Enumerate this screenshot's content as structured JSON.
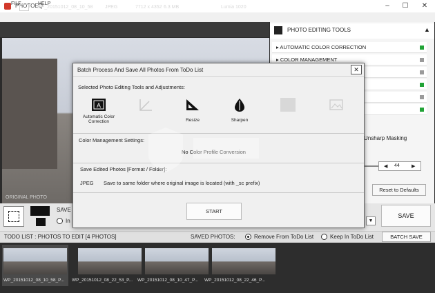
{
  "window": {
    "title": "PHOTOEQ",
    "controls": [
      "–",
      "☐",
      "✕"
    ]
  },
  "menu": [
    "FILE",
    "HELP"
  ],
  "info": {
    "filename": "WP_20151012_08_10_58",
    "format": "JPEG",
    "dimensions": "7712 x 4352",
    "size": "6.3 MB",
    "device": "Lumia 1020"
  },
  "photo": {
    "label": "ORIGINAL PHOTO"
  },
  "panel": {
    "title": "PHOTO EDITING TOOLS",
    "collapse": "▲",
    "tools": [
      {
        "label": "▸ AUTOMATIC COLOR CORRECTION",
        "color": "#21a336"
      },
      {
        "label": "▸ COLOR MANAGEMENT",
        "color": "#9a9a9a"
      },
      {
        "label": "",
        "color": "#9a9a9a"
      },
      {
        "label": "",
        "color": "#21a336"
      },
      {
        "label": "",
        "color": "#9a9a9a"
      },
      {
        "label": "",
        "color": "#21a336"
      }
    ],
    "unsharp": "Unsharp Masking",
    "stepper": {
      "left": "◀",
      "value": "44",
      "right": "▶"
    },
    "reset": "Reset to Defaults"
  },
  "tools_bar": {
    "save_label": "SAVE",
    "in_label": "In",
    "dropdown": "▼",
    "save_button": "SAVE"
  },
  "todo": {
    "title": "TODO LIST : PHOTOS TO EDIT   [4 PHOTOS]",
    "saved_label": "SAVED PHOTOS:",
    "option1": "Remove From ToDo List",
    "option2": "Keep In ToDo List",
    "batch_button": "BATCH SAVE"
  },
  "thumbnails": [
    "WP_20151012_08_10_58_P...",
    "WP_20151012_08_22_53_P...",
    "WP_20151012_08_10_47_P...",
    "WP_20151012_08_22_46_P..."
  ],
  "dialog": {
    "title": "Batch Process And Save All Photos From ToDo List",
    "close": "✕",
    "subtitle": "Selected Photo Editing Tools and Adjustments:",
    "tools": [
      {
        "caption": "Automatic Color Correction",
        "active": true
      },
      {
        "caption": "",
        "active": false
      },
      {
        "caption": "Resize",
        "active": true
      },
      {
        "caption": "Sharpen",
        "active": true
      },
      {
        "caption": "",
        "active": false
      },
      {
        "caption": "",
        "active": false
      }
    ],
    "cm_label": "Color Management Settings:",
    "cm_value": "No Color Profile Conversion",
    "save_section_label": "Save Edited Photos [Format / Folder]:",
    "format": "JPEG",
    "format_desc": "Save to same folder where original image is located  (with _sc prefix)",
    "start_button": "START"
  }
}
